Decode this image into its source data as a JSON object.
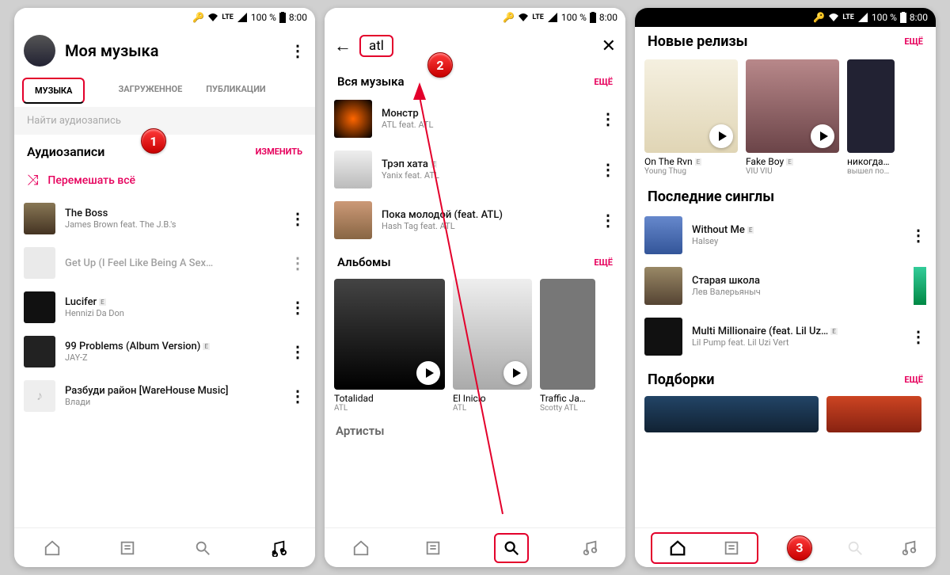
{
  "status_bar": {
    "network": "LTE",
    "battery": "100 %",
    "time": "8:00"
  },
  "screen1": {
    "title": "Моя музыка",
    "tabs": [
      "МУЗЫКА",
      "ЗАГРУЖЕННОЕ",
      "ПУБЛИКАЦИИ"
    ],
    "search_placeholder": "Найти аудиозапись",
    "section_audio": "Аудиозаписи",
    "edit": "ИЗМЕНИТЬ",
    "shuffle": "Перемешать всё",
    "tracks": [
      {
        "title": "The Boss",
        "artist": "James Brown feat. The J.B.'s"
      },
      {
        "title": "Get Up (I Feel Like Being A Sex…",
        "artist": "",
        "dim": true
      },
      {
        "title": "Lucifer",
        "artist": "Hennizi Da Don",
        "e": true
      },
      {
        "title": "99 Problems (Album Version)",
        "artist": "JAY-Z",
        "e": true
      },
      {
        "title": "Разбуди район [WareHouse Music]",
        "artist": "Влади"
      }
    ],
    "step": "1"
  },
  "screen2": {
    "search_value": "atl",
    "section_all_music": "Вся музыка",
    "more": "ЕЩЁ",
    "tracks": [
      {
        "title": "Монстр",
        "artist": "ATL feat. ATL"
      },
      {
        "title": "Трэп хата",
        "artist": "Yanix feat. ATL",
        "e": true
      },
      {
        "title": "Пока молодой (feat. ATL)",
        "artist": "Hash Tag feat. ATL"
      }
    ],
    "section_albums": "Альбомы",
    "albums": [
      {
        "title": "Totalidad",
        "artist": "ATL"
      },
      {
        "title": "El Inicio",
        "artist": "ATL"
      },
      {
        "title": "Traffic Ja…",
        "artist": "Scotty ATL"
      }
    ],
    "section_artists": "Артисты",
    "step": "2"
  },
  "screen3": {
    "section_releases": "Новые релизы",
    "more": "ЕЩЁ",
    "releases": [
      {
        "title": "On The Rvn",
        "artist": "Young Thug",
        "e": true
      },
      {
        "title": "Fake Boy",
        "artist": "VIU VIU",
        "e": true
      },
      {
        "title": "никогда…",
        "artist": "вышел по…"
      }
    ],
    "section_singles": "Последние синглы",
    "singles": [
      {
        "title": "Without Me",
        "artist": "Halsey",
        "e": true
      },
      {
        "title": "Старая школа",
        "artist": "Лев Валерьяныч"
      },
      {
        "title": "Multi Millionaire (feat. Lil Uz…",
        "artist": "Lil Pump feat. Lil Uzi Vert",
        "e": true
      }
    ],
    "section_picks": "Подборки",
    "step": "3"
  }
}
